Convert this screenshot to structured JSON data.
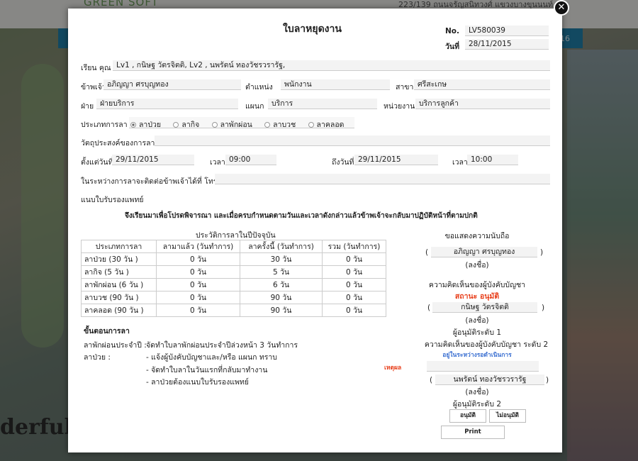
{
  "background": {
    "logo": "GREEN SOFT",
    "address": "223/139 ถนนจรัญสนิทวงศ์ แขวงบางขุนนนท์ เขต",
    "bar_text": "16",
    "word": "derful"
  },
  "form": {
    "title": "ใบลาหยุดงาน",
    "no_label": "No.",
    "no_value": "LV580039",
    "date_label": "วันที่",
    "date_value": "28/11/2015",
    "to_label": "เรียน คุณ",
    "to_value": "Lv1  , กนิษฐ วัตรจิตติ,  Lv2 , นพรัตน์ ทองวัชรวรารัฐ,",
    "name_label": "ข้าพเจ้า",
    "name_value": "อภิญญา ศรบุญทอง",
    "position_label": "ตำแหน่ง",
    "position_value": "พนักงาน",
    "branch_label": "สาขา",
    "branch_value": "ศรีสะเกษ",
    "division_label": "ฝ่าย",
    "division_value": "ฝ่ายบริการ",
    "dept_label": "แผนก",
    "dept_value": "บริการ",
    "unit_label": "หน่วยงาน",
    "unit_value": "บริการลูกค้า",
    "leave_type_label": "ประเภทการลา",
    "leave_types": [
      "ลาป่วย",
      "ลากิจ",
      "ลาพักผ่อน",
      "ลาบวช",
      "ลาคลอด"
    ],
    "purpose_label": "วัตถุประสงค์ของการลา",
    "purpose_value": "",
    "from_label": "ตั้งแต่วันที่",
    "from_value": "29/11/2015",
    "from_time_label": "เวลา",
    "from_time_value": "09:00",
    "to_date_label": "ถึงวันที่",
    "to_date_value": "29/11/2015",
    "to_time_label": "เวลา",
    "to_time_value": "10:00",
    "contact_label": "ในระหว่างการลาจะติดต่อข้าพเจ้าได้ที่ โทร.",
    "contact_value": "",
    "attach_label": "แนบใบรับรองแพทย์",
    "statement": "จึงเรียนมาเพื่อโปรดพิจารณา และเมื่อครบกำหนดตามวันและเวลาดังกล่าวแล้วข้าพเจ้าจะกลับมาปฏิบัติหน้าที่ตามปกติ"
  },
  "history": {
    "title": "ประวัติการลาในปีปัจจุบัน",
    "headers": [
      "ประเภทการลา",
      "ลามาแล้ว (วันทำการ)",
      "ลาครั้งนี้ (วันทำการ)",
      "รวม (วันทำการ)"
    ],
    "rows": [
      [
        "ลาป่วย (30 วัน )",
        "0 วัน",
        "30 วัน",
        "0 วัน"
      ],
      [
        "ลากิจ (5 วัน )",
        "0 วัน",
        "5 วัน",
        "0 วัน"
      ],
      [
        "ลาพักผ่อน (6 วัน )",
        "0 วัน",
        "6 วัน",
        "0 วัน"
      ],
      [
        "ลาบวช (90 วัน )",
        "0 วัน",
        "90 วัน",
        "0 วัน"
      ],
      [
        "ลาคลอด (90 วัน )",
        "0 วัน",
        "90 วัน",
        "0 วัน"
      ]
    ]
  },
  "procedure": {
    "title": "ขั้นตอนการลา",
    "annual_label": "ลาพักผ่อนประจำปี :",
    "annual_text": "จัดทำใบลาพักผ่อนประจำปีล่วงหน้า 3 วันทำการ",
    "sick_label": "ลาป่วย :",
    "sick_items": [
      "- แจ้งผู้บังคับบัญชาและ/หรือ แผนก ทราบ",
      "- จัดทำใบลาในวันแรกที่กลับมาทำงาน",
      "- ลาป่วยต้องแนบใบรับรองแพทย์"
    ]
  },
  "signatures": {
    "respect": "ขอแสดงความนับถือ",
    "requester_name": "อภิญญา ศรบุญทอง",
    "sign_label": "(ลงชื่อ)",
    "supervisor_opinion": "ความคิดเห็นของผู้บังคับบัญชา",
    "status": "สถานะ อนุมัติ",
    "approver1_name": "กนิษฐ วัตรจิตติ",
    "approver1_level": "ผู้อนุมัติระดับ 1",
    "supervisor_opinion2": "ความคิดเห็นของผู้บังคับบัญชา ระดับ 2",
    "pending": "อยู่ในระหว่างรอดำเนินการ",
    "reason_label": "เหตุผล",
    "reason_value": "",
    "approver2_name": "นพรัตน์ ทองวัชรวรารัฐ",
    "approver2_level": "ผู้อนุมัติระดับ 2",
    "approve_btn": "อนุมัติ",
    "reject_btn": "ไม่อนุมัติ",
    "print_btn": "Print",
    "open_paren": "(",
    "close_paren": ")"
  },
  "colors": {
    "status": "#e8401c",
    "pending": "#3a6fd1",
    "reason": "#e8401c",
    "topbar": "#1f7fa8"
  },
  "icons": {
    "close": "close-icon",
    "radio": "radio-button"
  }
}
